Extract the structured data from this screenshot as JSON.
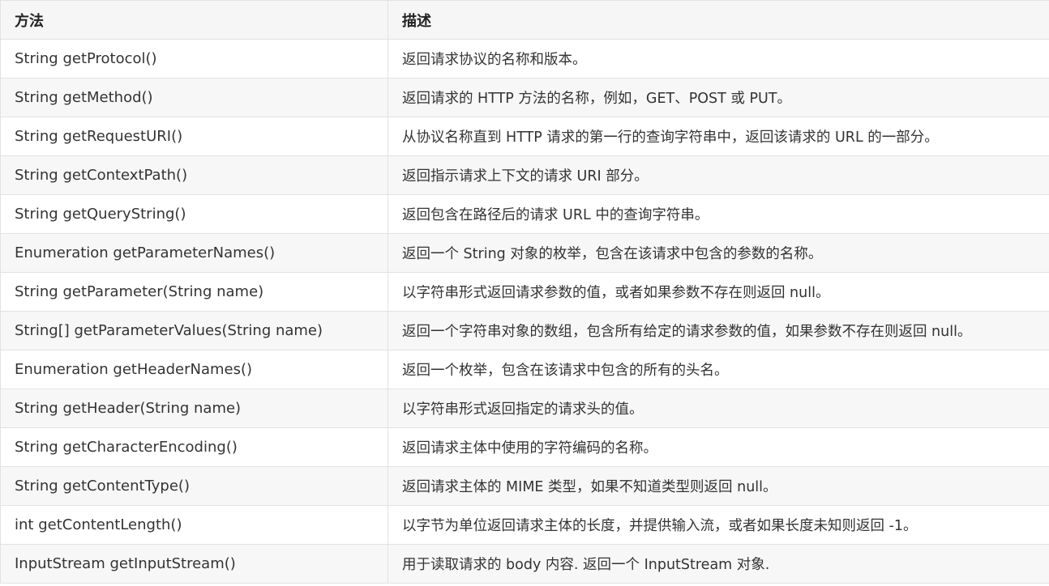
{
  "table": {
    "headers": [
      "方法",
      "描述"
    ],
    "rows": [
      {
        "method": "String getProtocol()",
        "description": "返回请求协议的名称和版本。"
      },
      {
        "method": "String getMethod()",
        "description": "返回请求的 HTTP 方法的名称，例如，GET、POST 或 PUT。"
      },
      {
        "method": "String getRequestURI()",
        "description": "从协议名称直到 HTTP 请求的第一行的查询字符串中，返回该请求的 URL 的一部分。"
      },
      {
        "method": "String getContextPath()",
        "description": "返回指示请求上下文的请求 URI 部分。"
      },
      {
        "method": "String getQueryString()",
        "description": "返回包含在路径后的请求 URL 中的查询字符串。"
      },
      {
        "method": "Enumeration getParameterNames()",
        "description": "返回一个 String 对象的枚举，包含在该请求中包含的参数的名称。"
      },
      {
        "method": "String getParameter(String name)",
        "description": "以字符串形式返回请求参数的值，或者如果参数不存在则返回 null。"
      },
      {
        "method": "String[] getParameterValues(String name)",
        "description": "返回一个字符串对象的数组，包含所有给定的请求参数的值，如果参数不存在则返回 null。"
      },
      {
        "method": "Enumeration getHeaderNames()",
        "description": "返回一个枚举，包含在该请求中包含的所有的头名。"
      },
      {
        "method": "String getHeader(String name)",
        "description": "以字符串形式返回指定的请求头的值。"
      },
      {
        "method": "String getCharacterEncoding()",
        "description": "返回请求主体中使用的字符编码的名称。"
      },
      {
        "method": "String getContentType()",
        "description": "返回请求主体的 MIME 类型，如果不知道类型则返回 null。"
      },
      {
        "method": "int getContentLength()",
        "description": "以字节为单位返回请求主体的长度，并提供输入流，或者如果长度未知则返回 -1。"
      },
      {
        "method": "InputStream getInputStream()",
        "description": "用于读取请求的 body 内容. 返回一个 InputStream 对象."
      }
    ]
  }
}
